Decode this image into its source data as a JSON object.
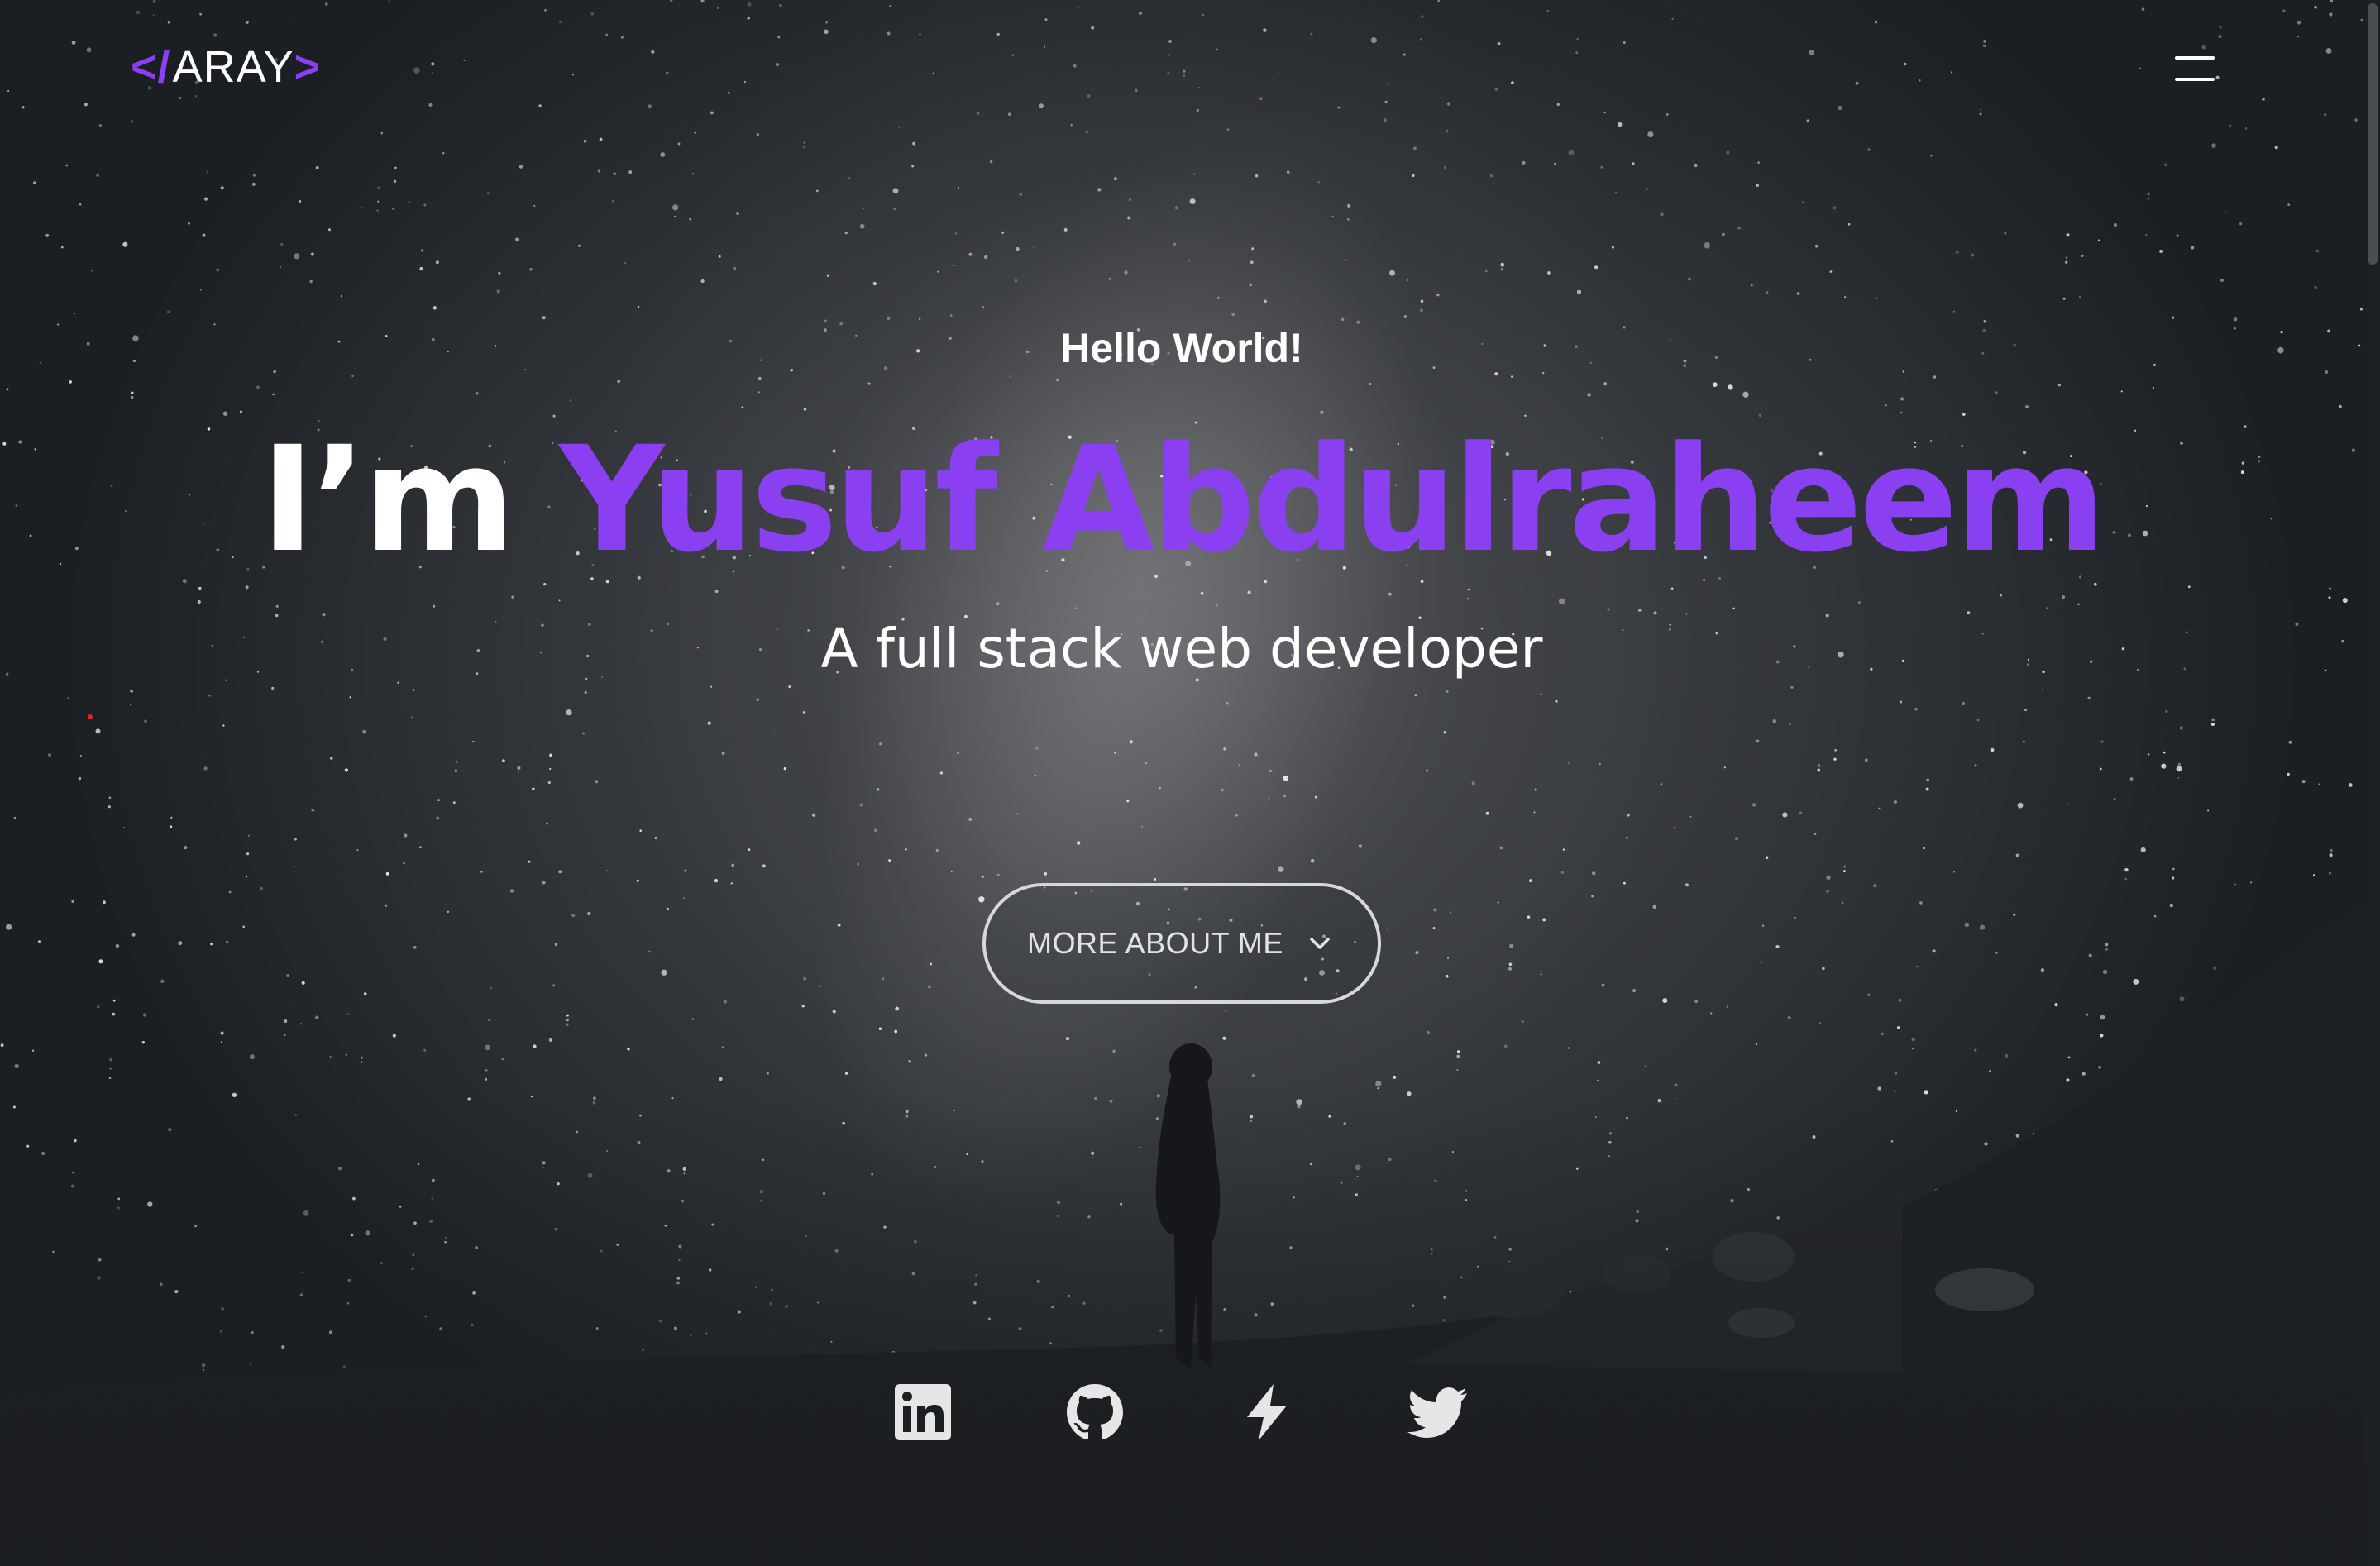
{
  "header": {
    "logo": {
      "open_bracket": "<",
      "slash": "/",
      "text": "ARAY",
      "close_bracket": ">"
    },
    "menu_icon": "hamburger-menu-icon"
  },
  "hero": {
    "greeting": "Hello World!",
    "intro": "I’m",
    "name": "Yusuf Abdulraheem",
    "tagline": "A full stack web developer",
    "cta": {
      "label": "MORE ABOUT ME",
      "icon": "chevron-down-icon"
    }
  },
  "socials": [
    {
      "icon": "linkedin-icon"
    },
    {
      "icon": "github-icon"
    },
    {
      "icon": "lightning-bolt-icon"
    },
    {
      "icon": "twitter-icon"
    }
  ],
  "colors": {
    "accent": "#8a3ff0",
    "background": "#1b1e22",
    "text": "#ffffff",
    "button_border": "#d8d8d8"
  }
}
